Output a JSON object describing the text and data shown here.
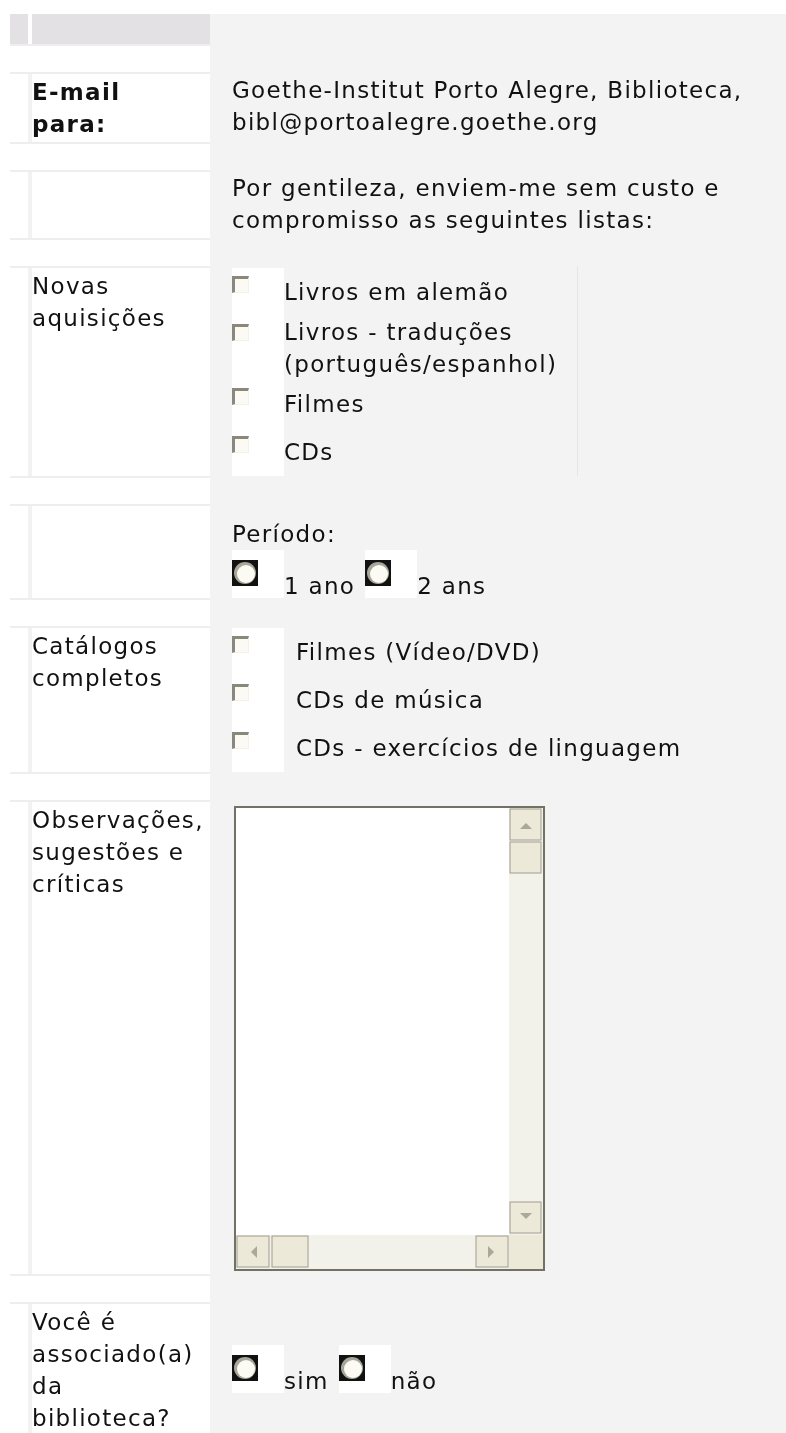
{
  "sections": [
    {
      "kind": "recipient",
      "label": "E-mail para:",
      "text": "Goethe-Institut Porto Alegre, Biblioteca, bibl@portoalegre.goethe.org"
    },
    {
      "kind": "note",
      "text": "Por gentileza, enviem-me sem custo e compromisso as seguintes listas:"
    },
    {
      "kind": "checklist",
      "label": "Novas aquisições",
      "items": [
        {
          "label": "Livros em alemão",
          "checked": false
        },
        {
          "label": "Livros - traduções (português/espanhol)",
          "checked": false
        },
        {
          "label": "Filmes",
          "checked": false
        },
        {
          "label": "CDs",
          "checked": false
        }
      ]
    },
    {
      "kind": "radios",
      "heading": "Período:",
      "options": [
        {
          "label": "1 ano",
          "selected": false
        },
        {
          "label": "2 ans",
          "selected": false
        }
      ]
    },
    {
      "kind": "catalog",
      "label": "Catálogos completos",
      "items": [
        {
          "label": "Filmes (Vídeo/DVD)",
          "checked": false
        },
        {
          "label": "CDs de música",
          "checked": false
        },
        {
          "label": "CDs - exercícios de linguagem",
          "checked": false
        }
      ]
    },
    {
      "kind": "textarea",
      "label": "Observações, sugestões e críticas"
    },
    {
      "kind": "radios",
      "label": "Você é associado(a) da biblioteca?",
      "options": [
        {
          "label": "sim",
          "selected": false
        },
        {
          "label": "não",
          "selected": false
        }
      ]
    }
  ]
}
